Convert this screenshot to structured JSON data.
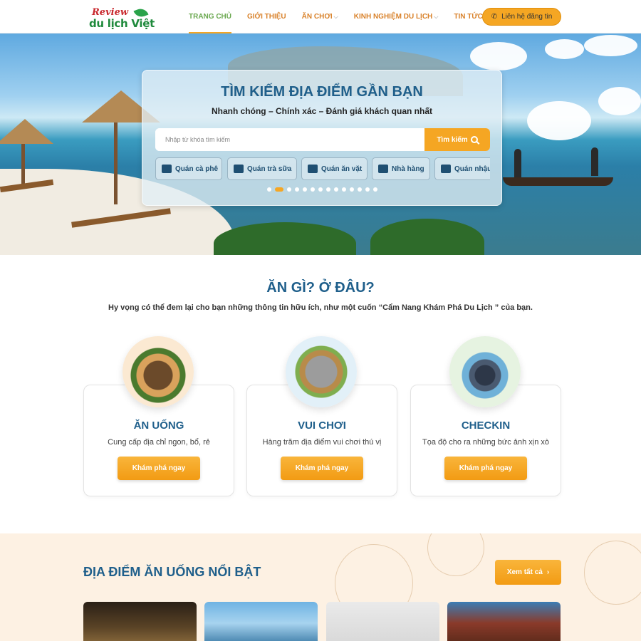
{
  "header": {
    "logo_top": "Review",
    "logo_main": "du lịch Việt",
    "nav": [
      {
        "label": "TRANG CHỦ",
        "active": true,
        "dropdown": false
      },
      {
        "label": "GIỚI THIỆU",
        "active": false,
        "dropdown": false
      },
      {
        "label": "ĂN CHƠI",
        "active": false,
        "dropdown": true
      },
      {
        "label": "KINH NGHIỆM DU LỊCH",
        "active": false,
        "dropdown": true
      },
      {
        "label": "TIN TỨC",
        "active": false,
        "dropdown": false
      }
    ],
    "contact_label": "Liên hệ đăng tin",
    "contact_icon": "phone-icon"
  },
  "hero": {
    "title": "TÌM KIẾM ĐỊA ĐIỂM GẦN BẠN",
    "subtitle": "Nhanh chóng – Chính xác – Đánh giá khách quan nhất",
    "search": {
      "placeholder": "Nhập từ khóa tìm kiếm",
      "value": "",
      "button_label": "Tìm kiếm",
      "button_icon": "search-icon"
    },
    "categories": [
      {
        "label": "Quán cà phê",
        "icon": "coffee-icon"
      },
      {
        "label": "Quán trà sữa",
        "icon": "milk-tea-icon"
      },
      {
        "label": "Quán ăn vặt",
        "icon": "snack-icon"
      },
      {
        "label": "Nhà hàng",
        "icon": "restaurant-icon"
      },
      {
        "label": "Quán nhậu",
        "icon": "beer-icon"
      }
    ],
    "slider": {
      "total_dots": 14,
      "active_index": 1
    }
  },
  "intro": {
    "title": "ĂN GÌ? Ở ĐÂU?",
    "description": "Hy vọng có thể đem lại cho bạn những thông tin hữu ích, như một cuốn “Cẩm Nang Khám Phá Du Lịch ” của bạn."
  },
  "cards": [
    {
      "title": "ĂN UỐNG",
      "description": "Cung cấp địa chỉ ngon, bổ, rẻ",
      "button": "Khám phá ngay",
      "image": "food-dish-image"
    },
    {
      "title": "VUI CHƠI",
      "description": "Hàng trăm địa điểm vui chơi thú vị",
      "button": "Khám phá ngay",
      "image": "golden-bridge-image"
    },
    {
      "title": "CHECKIN",
      "description": "Tọa độ cho ra những bức ảnh xịn xò",
      "button": "Khám phá ngay",
      "image": "camera-photos-image"
    }
  ],
  "featured": {
    "title": "ĐỊA ĐIỂM ĂN UỐNG NỔI BẬT",
    "see_all": "Xem tất cả",
    "thumbs": [
      "bar-thumbnail",
      "beach-thumbnail",
      "app-thumbnail",
      "pagoda-thumbnail"
    ]
  },
  "colors": {
    "brand_blue": "#1f5f8b",
    "accent_orange": "#f5a623",
    "nav_green": "#6aa84f",
    "nav_orange": "#d9822b"
  }
}
